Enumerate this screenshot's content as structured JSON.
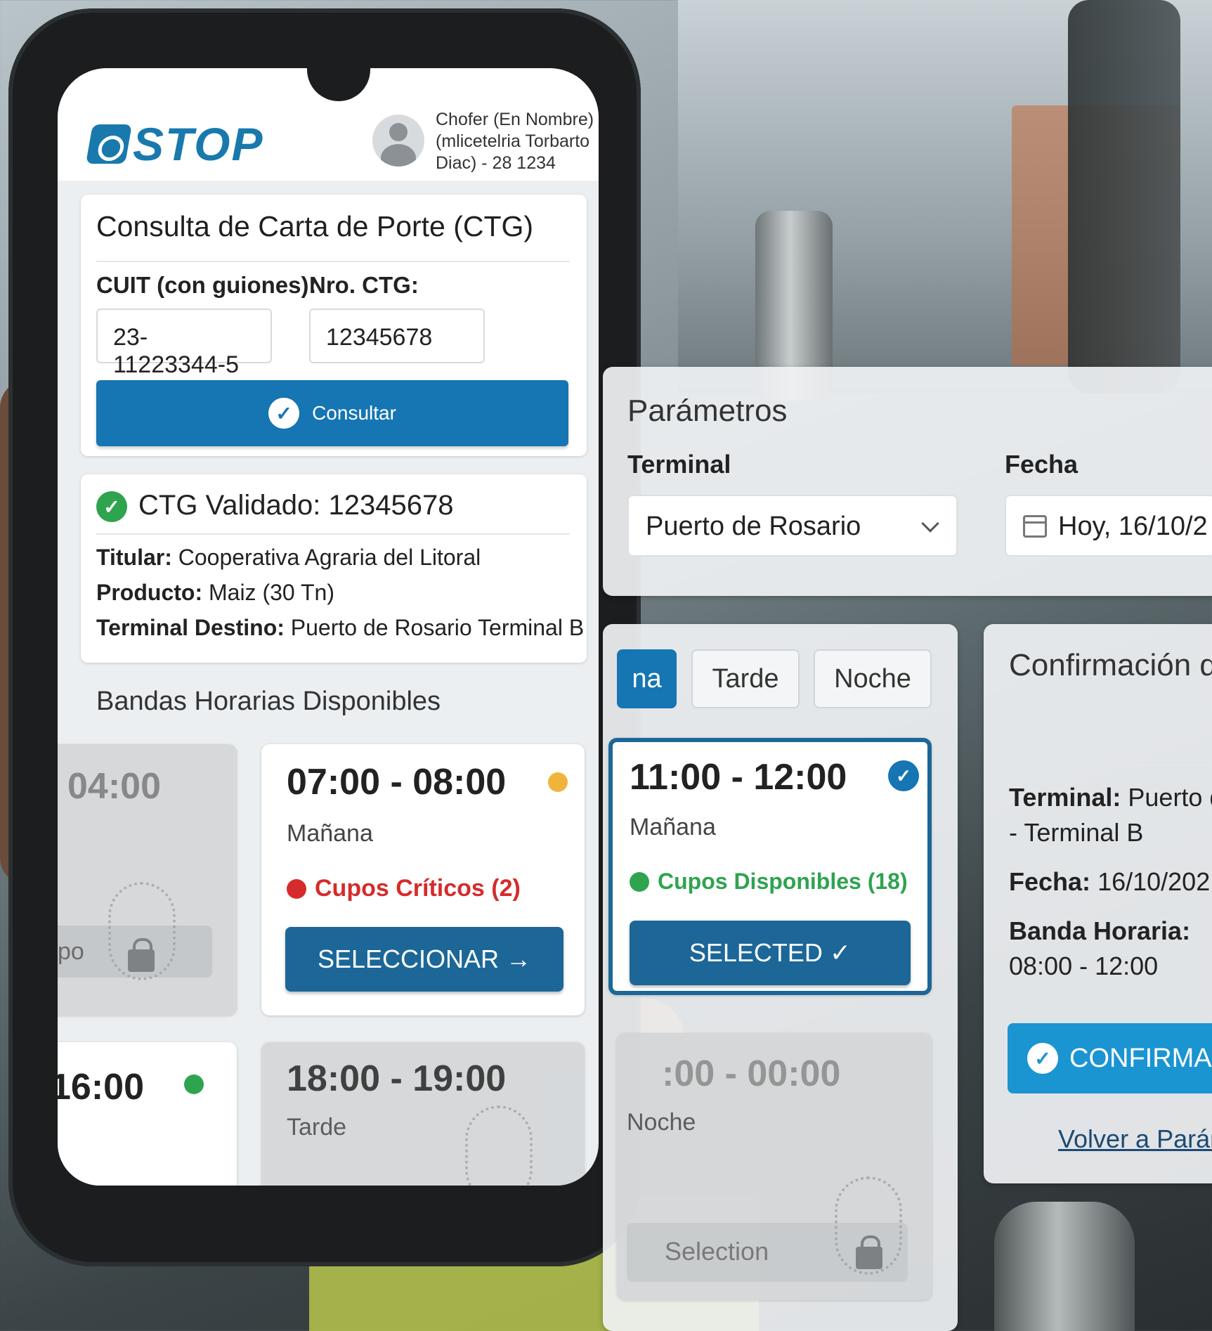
{
  "header": {
    "logo_text": "STOP",
    "driver_info": "Chofer (En Nombre) (mlicetelria Torbarto Diac) - 28 1234"
  },
  "ctg_form": {
    "title": "Consulta de Carta de Porte (CTG)",
    "cuit_label": "CUIT (con guiones):",
    "cuit_value": "23-11223344-5",
    "ctg_label": "Nro. CTG:",
    "ctg_value": "12345678",
    "submit_label": "Consultar"
  },
  "ctg_result": {
    "title": "CTG Validado: 12345678",
    "titular_label": "Titular:",
    "titular_value": "Cooperativa Agraria del Litoral",
    "producto_label": "Producto:",
    "producto_value": "Maiz (30 Tn)",
    "terminal_label": "Terminal Destino:",
    "terminal_value": "Puerto de Rosario Terminal B"
  },
  "bandas": {
    "title": "Bandas Horarias Disponibles",
    "slots": [
      {
        "time": "04:00",
        "partial_label": "po"
      },
      {
        "time": "07:00 - 08:00",
        "period": "Mañana",
        "status": "Cupos Críticos (2)",
        "button": "SELECCIONAR →",
        "status_color": "#d62b2b",
        "indicator_color": "#f0b43a"
      },
      {
        "time": "16:00",
        "indicator_color": "#2ea44f"
      },
      {
        "time": "18:00 - 19:00",
        "period": "Tarde"
      }
    ]
  },
  "parametros": {
    "title": "Parámetros",
    "terminal_label": "Terminal",
    "terminal_value": "Puerto de Rosario",
    "fecha_label": "Fecha",
    "fecha_value": "Hoy, 16/10/2"
  },
  "shift_tabs": {
    "tabs": [
      "na",
      "Tarde",
      "Noche"
    ],
    "active_index": 0
  },
  "selected_slot": {
    "time": "11:00 - 12:00",
    "period": "Mañana",
    "status": "Cupos Disponibles (18)",
    "button": "SELECTED ✓",
    "status_color": "#2ea44f"
  },
  "night_slot": {
    "time": ":00 - 00:00",
    "period": "Noche",
    "button": "Selection"
  },
  "confirmacion": {
    "title": "Confirmación d",
    "terminal_label": "Terminal:",
    "terminal_value": "Puerto d",
    "terminal_line2": "- Terminal B",
    "fecha_label": "Fecha:",
    "fecha_value": "16/10/202",
    "banda_label": "Banda Horaria:",
    "banda_value": "08:00 - 12:00",
    "confirm_button": "CONFIRMAR",
    "back_link": "Volver a Parám"
  },
  "colors": {
    "primary": "#1675b3",
    "button_dark": "#1c6797",
    "confirm": "#1b94d2",
    "success": "#2ea44f",
    "critical": "#d62b2b"
  }
}
